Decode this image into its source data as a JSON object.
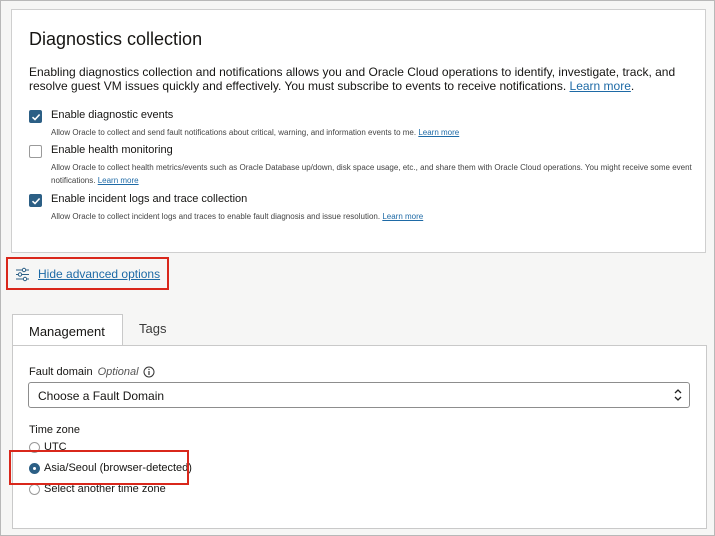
{
  "diagnostics": {
    "title": "Diagnostics collection",
    "description": "Enabling diagnostics collection and notifications allows you and Oracle Cloud operations to identify, investigate, track, and resolve guest VM issues quickly and effectively. You must subscribe to events to receive notifications.",
    "learn_more": "Learn more",
    "options": [
      {
        "label": "Enable diagnostic events",
        "checked": true,
        "help": "Allow Oracle to collect and send fault notifications about critical, warning, and information events to me.",
        "learn_more": "Learn more"
      },
      {
        "label": "Enable health monitoring",
        "checked": false,
        "help": "Allow Oracle to collect health metrics/events such as Oracle Database up/down, disk space usage, etc., and share them with Oracle Cloud operations. You might receive some event notifications.",
        "learn_more": "Learn more"
      },
      {
        "label": "Enable incident logs and trace collection",
        "checked": true,
        "help": "Allow Oracle to collect incident logs and traces to enable fault diagnosis and issue resolution.",
        "learn_more": "Learn more"
      }
    ]
  },
  "advanced": {
    "toggle_label": "Hide advanced options",
    "icon": "sliders-icon"
  },
  "tabs": [
    {
      "label": "Management",
      "active": true
    },
    {
      "label": "Tags",
      "active": false
    }
  ],
  "management": {
    "fault_domain_label": "Fault domain",
    "fault_domain_optional": "Optional",
    "fault_domain_value": "Choose a Fault Domain",
    "time_zone_label": "Time zone",
    "time_zone_options": [
      {
        "label": "UTC",
        "selected": false
      },
      {
        "label": "Asia/Seoul (browser-detected)",
        "selected": true
      },
      {
        "label": "Select another time zone",
        "selected": false
      }
    ]
  },
  "colors": {
    "accent": "#2c5f85",
    "link": "#1e6aa6",
    "highlight_box": "#d9271b"
  }
}
